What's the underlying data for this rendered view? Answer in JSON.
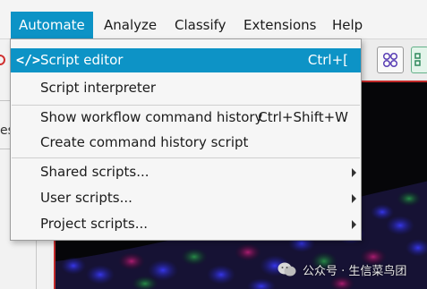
{
  "menubar": {
    "items": [
      {
        "label": "Automate",
        "active": true
      },
      {
        "label": "Analyze"
      },
      {
        "label": "Classify"
      },
      {
        "label": "Extensions"
      },
      {
        "label": "Help"
      }
    ]
  },
  "background": {
    "clipped_label": "es",
    "watermark": {
      "icon": "wechat-icon",
      "text": "公众号 · 生信菜鸟团"
    }
  },
  "automate_menu": {
    "items": [
      {
        "label": "Script editor",
        "shortcut": "Ctrl+[",
        "icon": "code-icon",
        "highlighted": true
      },
      {
        "label": "Script interpreter"
      },
      {
        "label": "Show workflow command history",
        "shortcut": "Ctrl+Shift+W"
      },
      {
        "label": "Create command history script"
      },
      {
        "label": "Shared scripts...",
        "submenu": true
      },
      {
        "label": "User scripts...",
        "submenu": true
      },
      {
        "label": "Project scripts...",
        "submenu": true
      }
    ],
    "code_icon_glyph": "</>"
  },
  "colors": {
    "accent": "#0d93c6",
    "menu_background": "#f6f6f6",
    "viewer_border": "#c22a2a"
  }
}
